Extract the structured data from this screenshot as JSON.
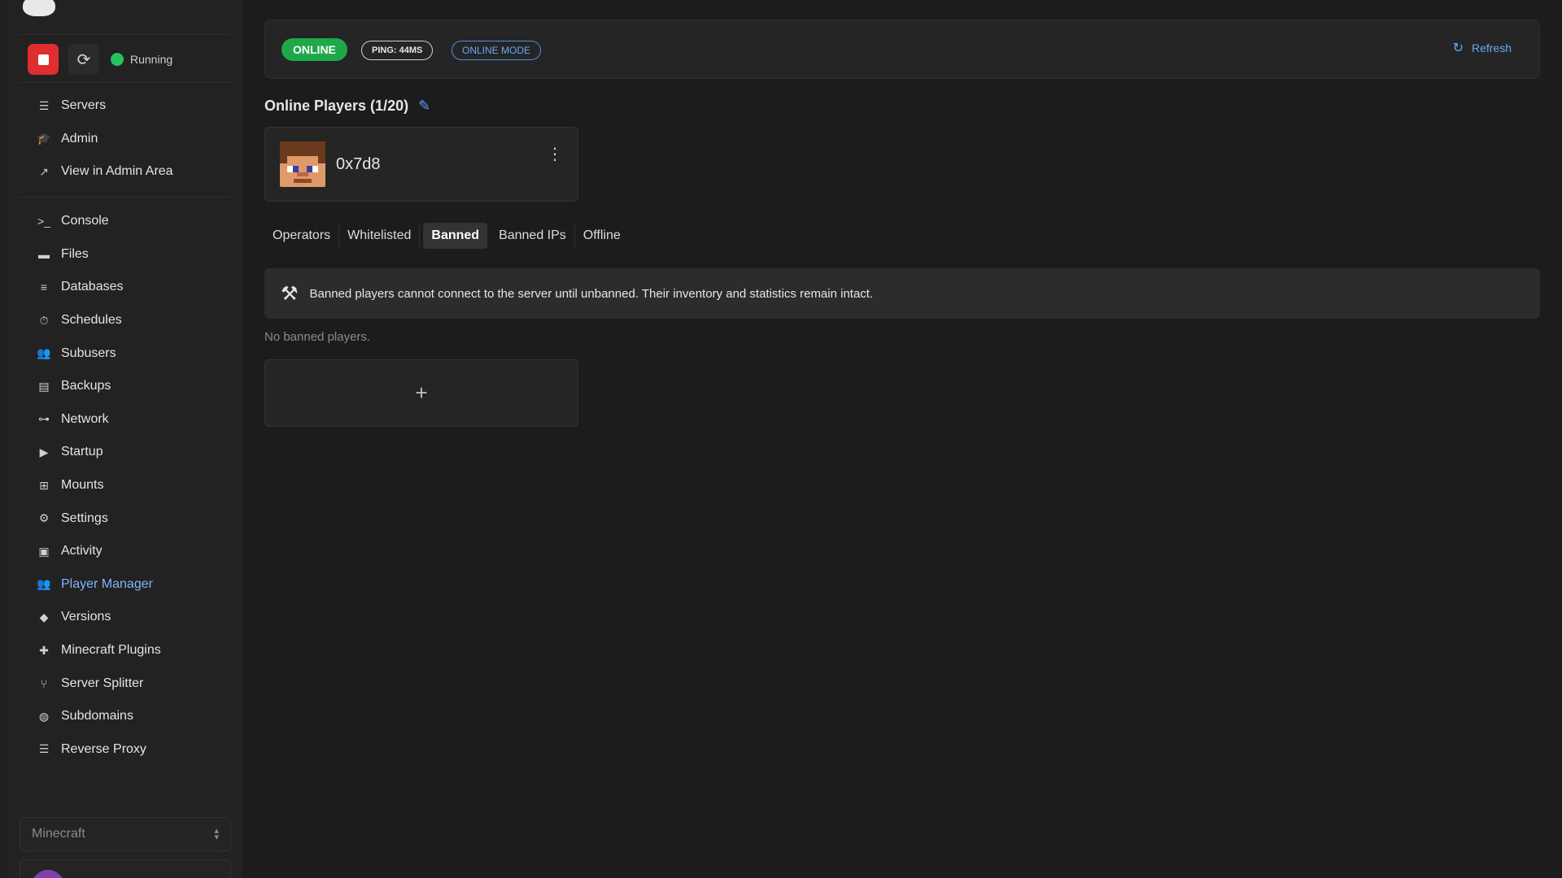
{
  "sidebar": {
    "status": "Running",
    "nav_group_1": [
      {
        "label": "Servers",
        "icon": "server-icon"
      },
      {
        "label": "Admin",
        "icon": "graduation-cap-icon"
      },
      {
        "label": "View in Admin Area",
        "icon": "external-link-icon"
      }
    ],
    "nav_group_2": [
      {
        "label": "Console",
        "icon": "terminal-icon"
      },
      {
        "label": "Files",
        "icon": "folder-icon"
      },
      {
        "label": "Databases",
        "icon": "database-icon"
      },
      {
        "label": "Schedules",
        "icon": "stopwatch-icon"
      },
      {
        "label": "Subusers",
        "icon": "users-icon"
      },
      {
        "label": "Backups",
        "icon": "archive-icon"
      },
      {
        "label": "Network",
        "icon": "network-icon"
      },
      {
        "label": "Startup",
        "icon": "play-icon"
      },
      {
        "label": "Mounts",
        "icon": "mount-icon"
      },
      {
        "label": "Settings",
        "icon": "gear-icon"
      },
      {
        "label": "Activity",
        "icon": "briefcase-icon"
      },
      {
        "label": "Player Manager",
        "icon": "users-icon",
        "active": true
      },
      {
        "label": "Versions",
        "icon": "tag-icon"
      },
      {
        "label": "Minecraft Plugins",
        "icon": "puzzle-icon"
      },
      {
        "label": "Server Splitter",
        "icon": "branch-icon"
      },
      {
        "label": "Subdomains",
        "icon": "globe-icon"
      },
      {
        "label": "Reverse Proxy",
        "icon": "server-icon"
      }
    ],
    "server_select": "Minecraft"
  },
  "topbar": {
    "status_badge": "ONLINE",
    "ping_badge": "PING: 44MS",
    "mode_badge": "ONLINE MODE",
    "refresh_label": "Refresh"
  },
  "online_players": {
    "title": "Online Players (1/20)",
    "players": [
      {
        "name": "0x7d8"
      }
    ]
  },
  "tabs": [
    {
      "label": "Operators"
    },
    {
      "label": "Whitelisted"
    },
    {
      "label": "Banned",
      "active": true
    },
    {
      "label": "Banned IPs"
    },
    {
      "label": "Offline"
    }
  ],
  "banned": {
    "info": "Banned players cannot connect to the server until unbanned. Their inventory and statistics remain intact.",
    "empty_text": "No banned players.",
    "add_symbol": "+"
  },
  "colors": {
    "accent": "#7fb4ff",
    "online": "#1fa84a",
    "stop": "#e02d2d",
    "running": "#22c55e"
  }
}
